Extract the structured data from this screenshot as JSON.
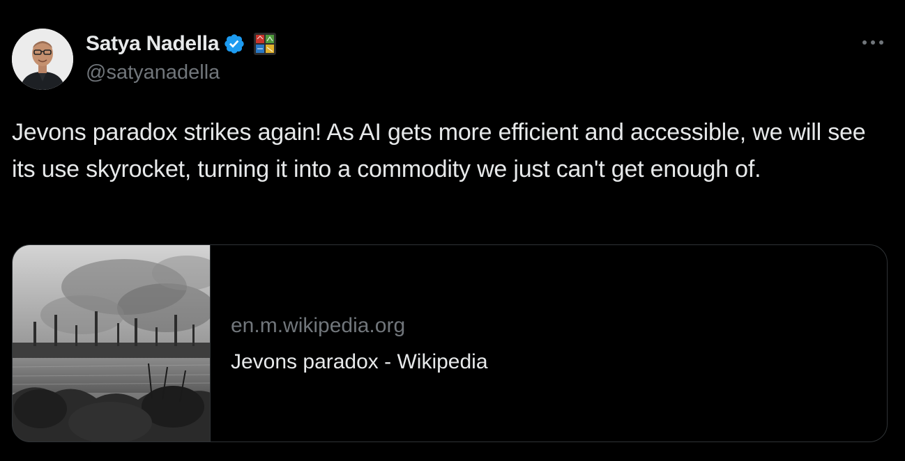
{
  "author": {
    "display_name": "Satya Nadella",
    "handle": "@satyanadella",
    "verified_icon": "verified-badge-icon",
    "affiliate_icon": "microsoft-affiliate-icon"
  },
  "tweet": {
    "text": "Jevons paradox strikes again! As AI gets more efficient and accessible, we will see its use skyrocket, turning it into a commodity we just can't get enough of."
  },
  "link_card": {
    "domain": "en.m.wikipedia.org",
    "title": "Jevons paradox - Wikipedia",
    "image": "industrial-city-engraving"
  },
  "colors": {
    "background": "#000000",
    "primary_text": "#e7e9ea",
    "secondary_text": "#71767b",
    "verified_blue": "#1d9bf0",
    "card_border": "#2f3336"
  },
  "icons": {
    "more": "more-options-icon"
  }
}
